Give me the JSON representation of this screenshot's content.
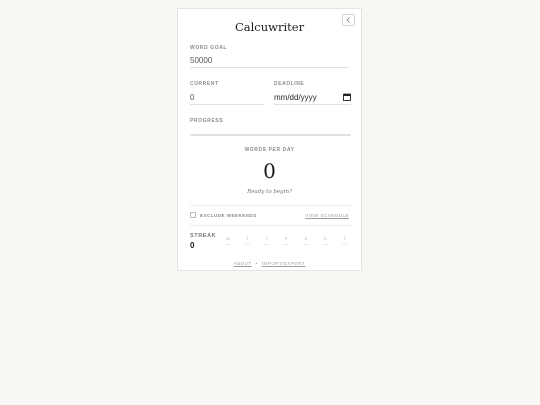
{
  "app": {
    "title": "Calcuwriter"
  },
  "form": {
    "word_goal_label": "WORD GOAL",
    "word_goal_value": "50000",
    "current_label": "CURRENT",
    "current_value": "0",
    "deadline_label": "DEADLINE",
    "deadline_placeholder": "mm/dd/yyyy",
    "progress_label": "PROGRESS",
    "progress_fraction": 0
  },
  "summary": {
    "words_per_day_label": "WORDS PER DAY",
    "words_per_day_value": "0",
    "subtitle": "Ready to begin?"
  },
  "options": {
    "exclude_weekends_label": "EXCLUDE WEEKENDS",
    "view_schedule_label": "VIEW SCHEDULE"
  },
  "streak": {
    "label": "STREAK",
    "count": "0",
    "days": [
      {
        "letter": "M",
        "mark": "—"
      },
      {
        "letter": "T",
        "mark": "—"
      },
      {
        "letter": "T",
        "mark": "—"
      },
      {
        "letter": "F",
        "mark": "—"
      },
      {
        "letter": "S",
        "mark": "—"
      },
      {
        "letter": "S",
        "mark": "—"
      },
      {
        "letter": "T",
        "mark": "—"
      }
    ]
  },
  "footer": {
    "about_label": "ABOUT",
    "separator": "•",
    "import_export_label": "IMPORT/EXPORT"
  },
  "icons": {
    "collapse": "chevron-left-icon",
    "calendar": "calendar-icon"
  }
}
